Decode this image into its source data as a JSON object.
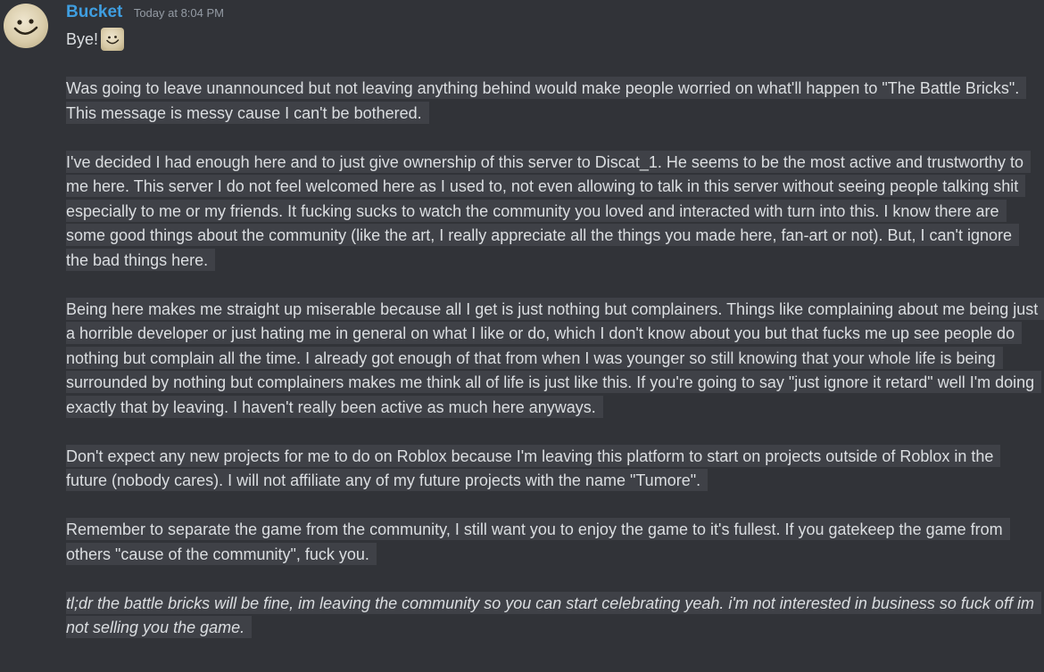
{
  "message": {
    "author": "Bucket",
    "timestamp": "Today at 8:04 PM",
    "avatar_icon": "smiley-face-avatar",
    "first_line": "Bye!",
    "emoji": "smiley-emoji",
    "paragraphs": [
      {
        "text": "Was going to leave unannounced but not leaving anything behind would make people worried on what'll happen to \"The Battle Bricks\". This message is messy cause I can't be bothered.",
        "style": "normal"
      },
      {
        "text": "I've decided I had enough here and to just give ownership of this server to Discat_1. He seems to be the most active and trustworthy to me here. This server I do not feel welcomed here as I used to, not even allowing to talk in this server without seeing people talking shit especially to me or my friends. It fucking sucks to watch the community you loved and interacted with turn into this. I know there are some good things about the community (like the art, I really appreciate all the things you made here, fan-art or not). But, I can't ignore the bad things here.",
        "style": "normal"
      },
      {
        "text": "Being here makes me straight up miserable because all I get is just nothing but complainers. Things like complaining about me being just a horrible developer or just hating me in general on what I like or do, which I don't know about you but that fucks me up see people do nothing but complain all the time. I already got enough of that from when I was younger so still knowing that your whole life is being surrounded by nothing but complainers makes me think all of life is just like this. If you're going to say \"just ignore it retard\" well I'm doing exactly that by leaving. I haven't really been active as much here anyways.",
        "style": "normal"
      },
      {
        "text": "Don't expect any new projects for me to do on Roblox because I'm leaving this platform to start on projects outside of Roblox in the future (nobody cares). I will not affiliate any of my future projects with the name \"Tumore\".",
        "style": "normal"
      },
      {
        "text": "Remember to separate the game from the community, I still want you to enjoy the game to it's fullest. If you gatekeep the game from others \"cause of the community\", fuck you.",
        "style": "normal"
      },
      {
        "text": "tl;dr the battle bricks will be fine, im leaving the community so you can start celebrating yeah. i'm not interested in business so fuck off im not selling you the game.",
        "style": "italic"
      }
    ]
  },
  "colors": {
    "background": "#313338",
    "text": "#dbdee1",
    "username": "#3f9ee0",
    "timestamp": "#949ba4",
    "highlight": "#3f4147"
  }
}
